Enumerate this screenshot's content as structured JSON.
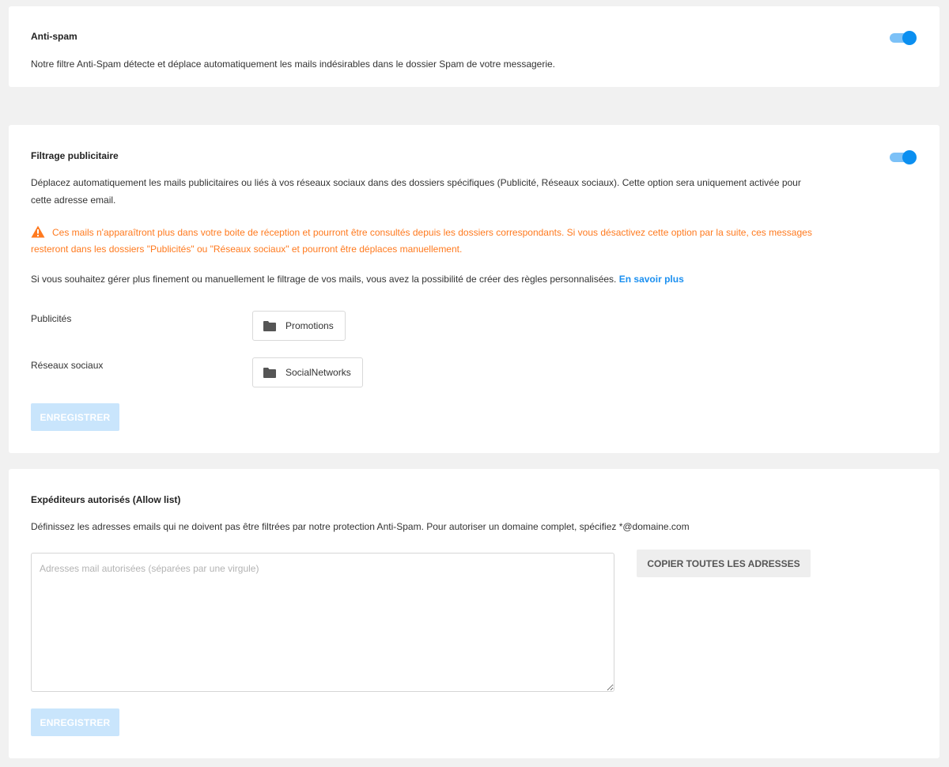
{
  "antispam": {
    "title": "Anti-spam",
    "description": "Notre filtre Anti-Spam détecte et déplace automatiquement les mails indésirables dans le dossier Spam de votre messagerie.",
    "enabled": true
  },
  "ad_filter": {
    "title": "Filtrage publicitaire",
    "enabled": true,
    "description_line1": "Déplacez automatiquement les mails publicitaires ou liés à vos réseaux sociaux dans des dossiers spécifiques (Publicité, Réseaux sociaux). Cette option sera uniquement activée pour",
    "description_line2": "cette adresse email.",
    "warning_line1": "Ces mails n'apparaîtront plus dans votre boite de réception et pourront être consultés depuis les dossiers correspondants. Si vous désactivez cette option par la suite, ces messages",
    "warning_line2": "resteront dans les dossiers \"Publicités\" ou \"Réseaux sociaux\" et pourront être déplaces manuellement.",
    "rules_text": "Si vous souhaitez gérer plus finement ou manuellement le filtrage de vos mails, vous avez la possibilité de créer des règles personnalisées.",
    "learn_more": "En savoir plus",
    "folders": [
      {
        "label": "Publicités",
        "folder": "Promotions"
      },
      {
        "label": "Réseaux sociaux",
        "folder": "SocialNetworks"
      }
    ],
    "save_label": "ENREGISTRER"
  },
  "allow_list": {
    "title": "Expéditeurs autorisés (Allow list)",
    "description": "Définissez les adresses emails qui ne doivent pas être filtrées par notre protection Anti-Spam. Pour autoriser un domaine complet, spécifiez *@domaine.com",
    "placeholder": "Adresses mail autorisées (séparées par une virgule)",
    "value": "",
    "copy_label": "COPIER TOUTES LES ADRESSES",
    "save_label": "ENREGISTRER"
  },
  "colors": {
    "accent": "#0b8ff0",
    "toggle_track": "#7cc1f7",
    "warning": "#ff7a1f",
    "save_disabled": "#c9e5fc",
    "background": "#f1f1f1"
  },
  "icons": {
    "warning": "warning-triangle-icon",
    "folder": "folder-icon"
  }
}
